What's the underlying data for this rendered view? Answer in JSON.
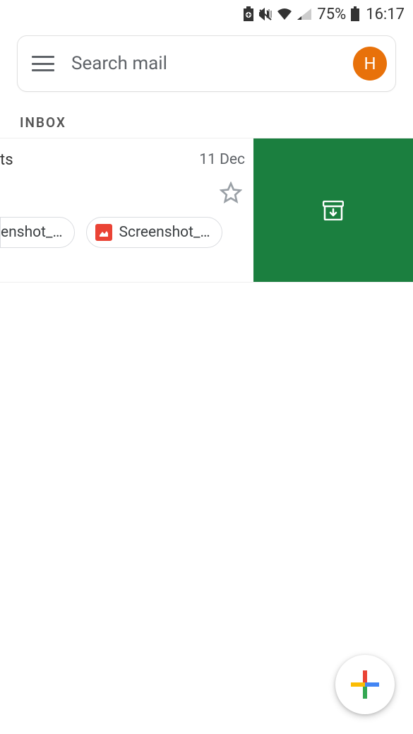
{
  "status_bar": {
    "battery_pct": "75%",
    "time": "16:17"
  },
  "search": {
    "placeholder": "Search mail",
    "avatar_initial": "H"
  },
  "section": {
    "label": "INBOX"
  },
  "email": {
    "sender_cut": "ts",
    "date": "11 Dec",
    "attachments": [
      {
        "label": "enshot_…"
      },
      {
        "label": "Screenshot_…"
      }
    ]
  },
  "colors": {
    "archive": "#1b7f3f",
    "avatar": "#e8710a"
  }
}
